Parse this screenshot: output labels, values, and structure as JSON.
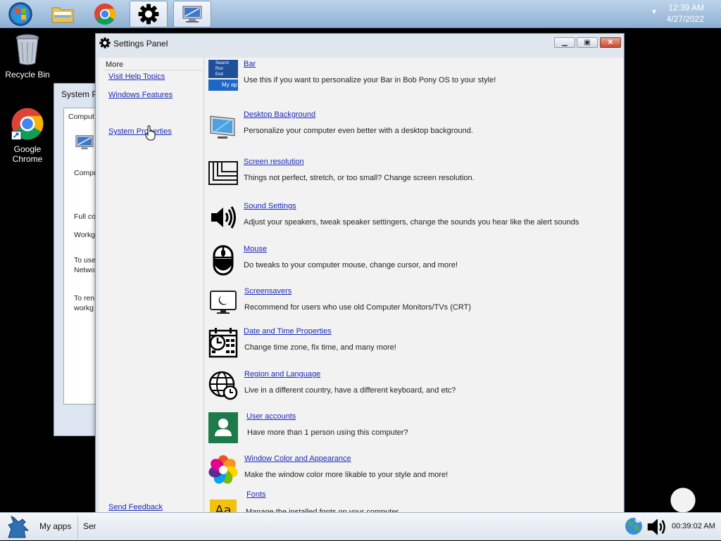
{
  "top_taskbar": {
    "clock_time": "12:39 AM",
    "clock_date": "4/27/2022",
    "pinned": [
      "start-orb",
      "file-explorer",
      "google-chrome",
      "settings",
      "system-properties"
    ]
  },
  "desktop": {
    "icons": [
      {
        "label": "Recycle Bin",
        "icon": "recycle-bin-icon"
      },
      {
        "label": "Google Chrome",
        "label_line1": "Google",
        "label_line2": "Chrome",
        "icon": "chrome-icon"
      }
    ]
  },
  "background_window": {
    "title": "System P",
    "fragments": [
      "Comput",
      "Compu",
      "Full co",
      "Workg",
      "To use",
      "Netwo",
      "To ren",
      "workg"
    ]
  },
  "settings_window": {
    "title": "Settings Panel",
    "sidebar": {
      "heading": "More",
      "links": [
        "Visit Help Topics",
        "Windows Features",
        "System Properties"
      ],
      "feedback": "Send Feedback"
    },
    "items": [
      {
        "name": "Bar",
        "desc": "Use this if you want to personalize your Bar in Bob Pony OS to your style!",
        "icon": "bar-preview-icon"
      },
      {
        "name": "Desktop Background",
        "desc": "Personalize your computer even better with a desktop background.",
        "icon": "monitor-wallpaper-icon"
      },
      {
        "name": "Screen resolution",
        "desc": "Things not perfect, stretch, or too small? Change screen resolution.",
        "icon": "screen-resolution-icon"
      },
      {
        "name": "Sound Settings",
        "desc": "Adjust your speakers, tweak speaker settingers, change the sounds you hear like the alert sounds",
        "icon": "speaker-icon"
      },
      {
        "name": "Mouse",
        "desc": "Do tweaks to your computer mouse, change cursor, and more!",
        "icon": "mouse-icon"
      },
      {
        "name": "Screensavers",
        "desc": "Recommend for users who use old Computer Monitors/TVs (CRT)",
        "icon": "screensaver-monitor-icon"
      },
      {
        "name": "Date and Time Properties",
        "desc": "Change time zone, fix time, and many more!",
        "icon": "calendar-clock-icon"
      },
      {
        "name": "Region and Language",
        "desc": "Live in a different country, have a different keyboard, and etc?",
        "icon": "globe-clock-icon"
      },
      {
        "name": "User accounts",
        "desc": "Have more than 1 person using this computer?",
        "icon": "user-account-icon"
      },
      {
        "name": "Window Color and Appearance",
        "desc": "Make the window color more likable to your style and more!",
        "icon": "color-flower-icon"
      },
      {
        "name": "Fonts",
        "desc": "Manage the installed fonts on your computer.",
        "icon": "fonts-icon"
      }
    ],
    "bar_preview": {
      "line1": "Search",
      "line2": "Run",
      "line3": "End Session",
      "line4": "My ap"
    },
    "fonts_glyph": "Aa"
  },
  "bottom_taskbar": {
    "myapps_label": "My apps",
    "task_label": "Ser",
    "clock": "00:39:02 AM"
  },
  "colors": {
    "link": "#1a2ab8",
    "user_accounts": "#1e7a4a",
    "fonts_yellow": "#f4c20d",
    "close_red": "#c6472d"
  }
}
